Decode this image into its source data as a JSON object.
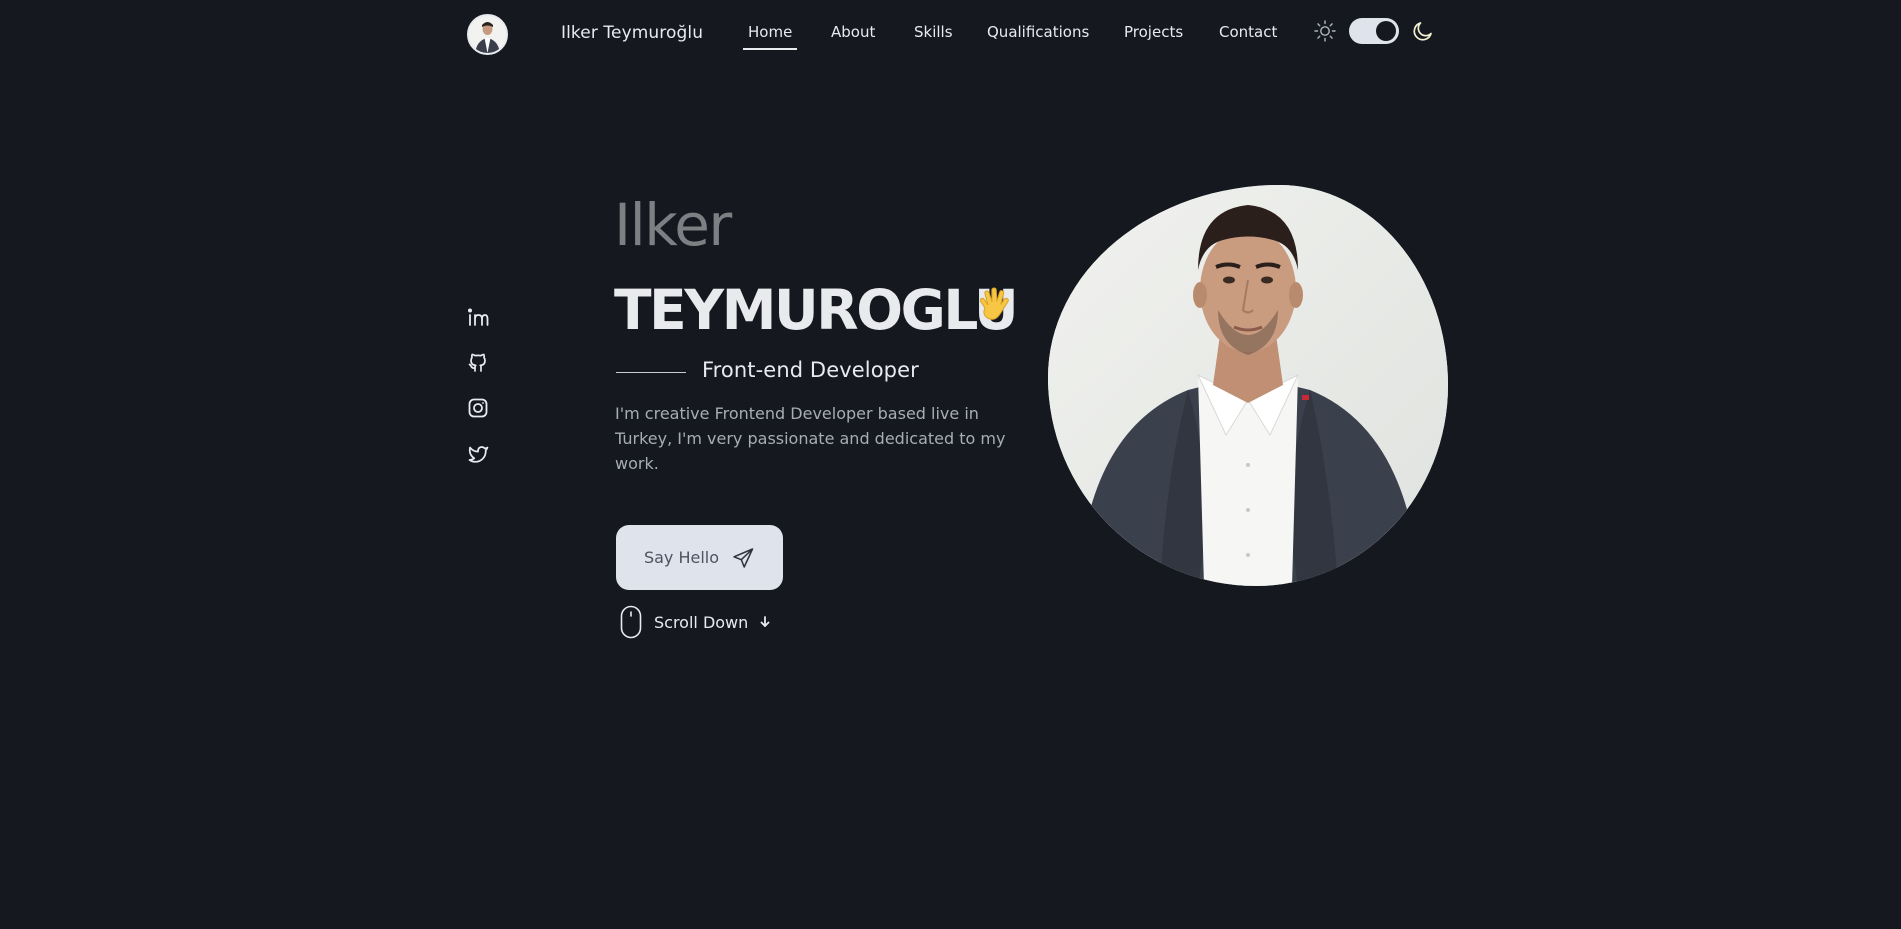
{
  "header": {
    "brand": "Ilker Teymuroğlu",
    "nav": [
      {
        "label": "Home",
        "active": true
      },
      {
        "label": "About"
      },
      {
        "label": "Skills"
      },
      {
        "label": "Qualifications"
      },
      {
        "label": "Projects"
      },
      {
        "label": "Contact"
      }
    ],
    "theme_toggle": {
      "icons": [
        "sun-icon",
        "moon-icon"
      ],
      "mode": "dark"
    }
  },
  "social": [
    "linkedin-icon",
    "github-icon",
    "instagram-icon",
    "twitter-icon"
  ],
  "hero": {
    "first_name": "Ilker",
    "last_name": "TEYMUROGLU",
    "wave_emoji": "hand-wave-icon",
    "role": "Front-end Developer",
    "description": "I'm creative Frontend Developer based live in Turkey, I'm very passionate and dedicated to my work.",
    "cta_label": "Say Hello",
    "scroll_label": "Scroll Down"
  },
  "colors": {
    "background": "#15191f",
    "text": "#e8eaee",
    "muted": "#7d7f83",
    "button_bg": "#dfe3ec",
    "accent_yellow": "#f6c644"
  }
}
